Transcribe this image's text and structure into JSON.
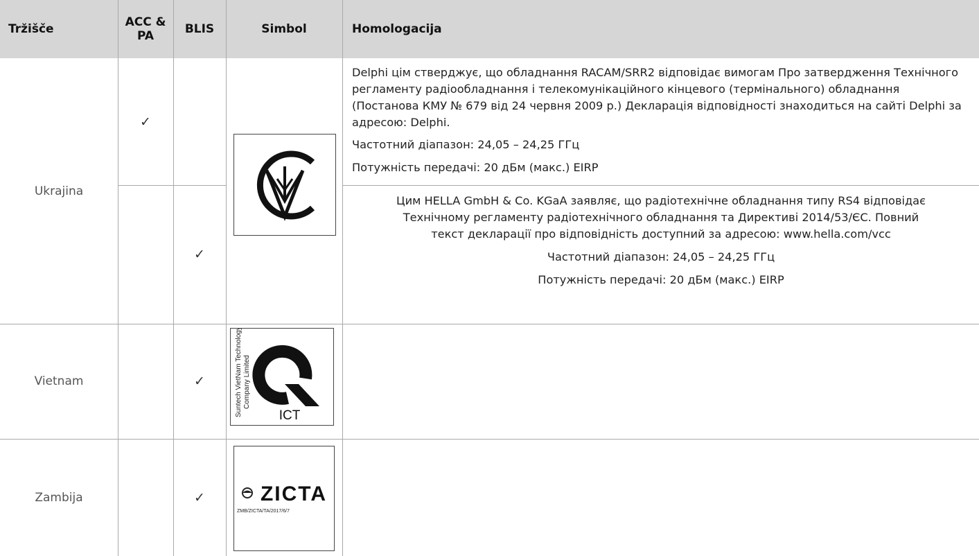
{
  "header": {
    "market": "Tržišče",
    "acc_pa": "ACC & PA",
    "blis": "BLIS",
    "symbol": "Simbol",
    "homologation": "Homologacija"
  },
  "rows": [
    {
      "market": "Ukrajina",
      "entries": [
        {
          "acc_pa_check": "✓",
          "paragraphs": [
            "Delphi цім стверджує, що обладнання RACAM/SRR2 відповідає вимогам Про затвердження Технічного регламенту радіообладнання і телекомунікаційного кінцевого (термінального) обладнання (Постанова КМУ № 679 від 24 червня 2009 р.) Декларація відповідності знаходиться на сайті Delphi за адресою: Delphi.",
            "Частотний діапазон: 24,05 – 24,25 ГГц",
            "Потужність передачі: 20 дБм (макс.) EIRP"
          ]
        },
        {
          "blis_check": "✓",
          "paragraphs": [
            "Цим HELLA GmbH & Co. KGaA заявляє, що радіотехнічне обладнання типу RS4 відповідає Технічному регламенту радіотехнічного обладнання та Директиві 2014/53/ЄС. Повний текст декларації про відповідність доступний за адресою: www.hella.com/vcc",
            "Частотний діапазон: 24,05 – 24,25 ГГц",
            "Потужність передачі: 20 дБм (макс.) EIRP"
          ]
        }
      ],
      "symbol_icon": "ukraine-conformity-mark-icon"
    },
    {
      "market": "Vietnam",
      "blis_check": "✓",
      "symbol_icon": "vietnam-ict-mark-icon",
      "symbol_text": {
        "side_line1": "Suntech VietNam Technology",
        "side_line2": "Company Limited",
        "label": "ICT"
      }
    },
    {
      "market": "Zambija",
      "blis_check": "✓",
      "symbol_icon": "zicta-logo-icon",
      "symbol_text": {
        "label": "ZICTA",
        "code": "ZMB/ZICTA/TA/2017/6/7"
      }
    }
  ],
  "colors": {
    "header_bg": "#d6d6d6",
    "rule": "#a9a9a9",
    "text": "#222222"
  }
}
